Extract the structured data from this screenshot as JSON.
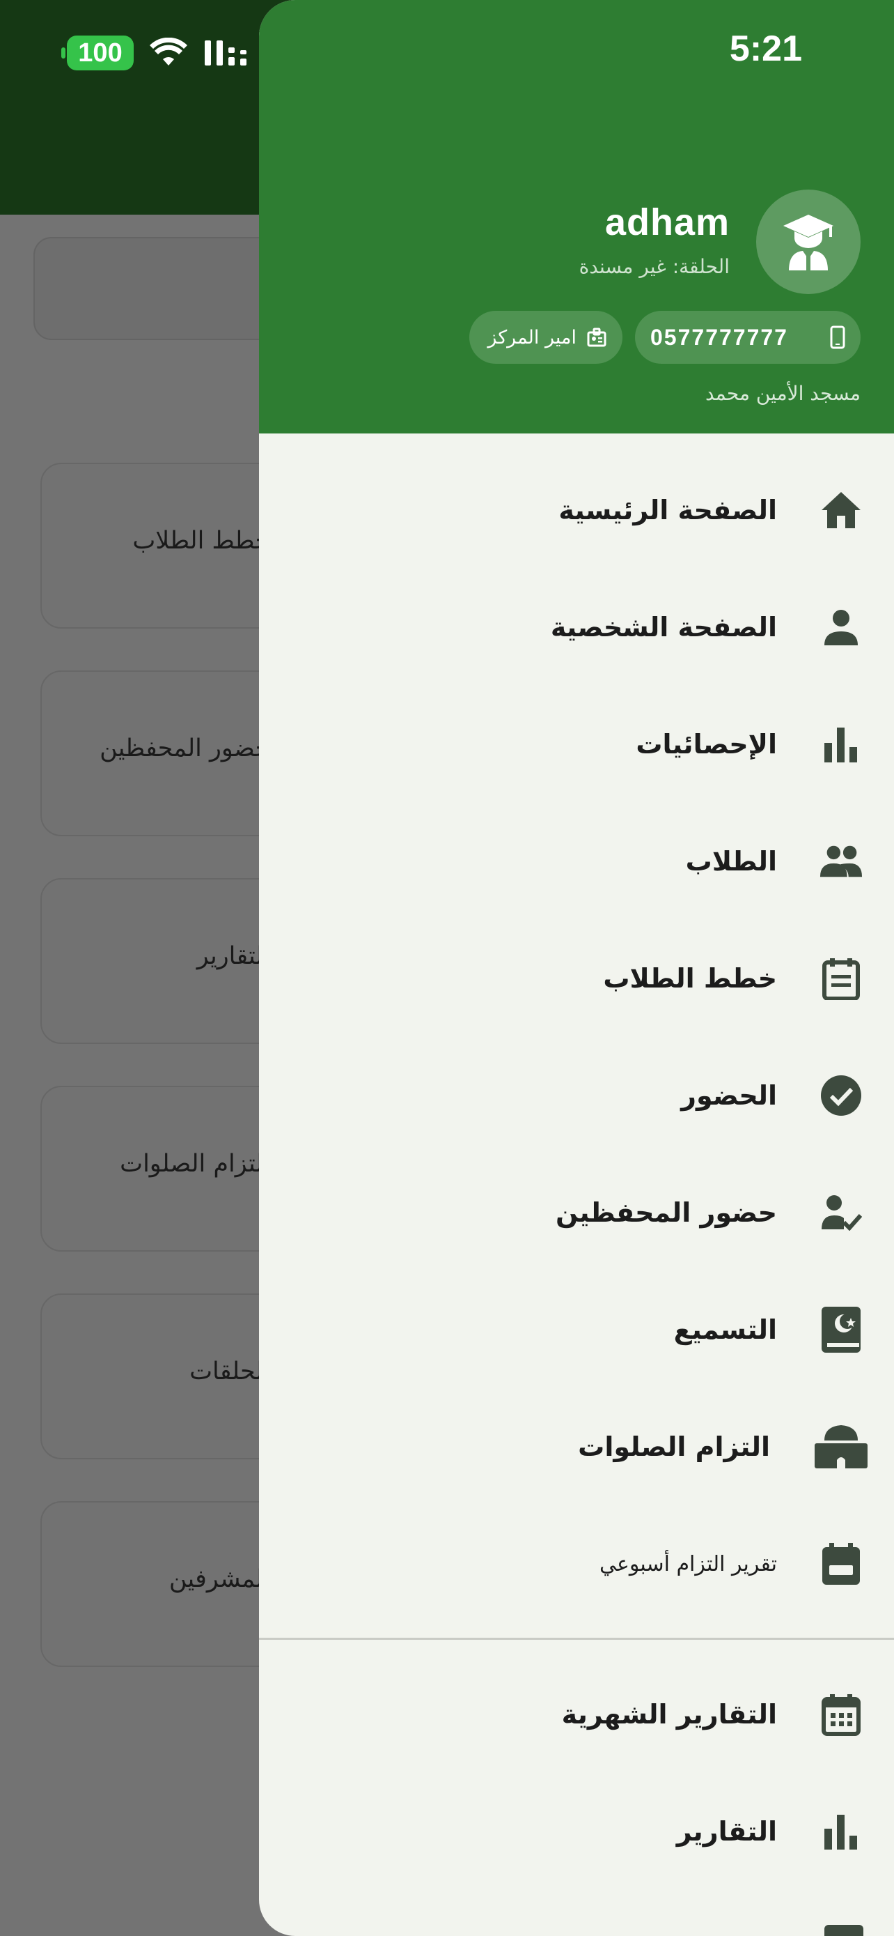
{
  "status_bar": {
    "time": "5:21",
    "battery": "100"
  },
  "background": {
    "cards": [
      "خطط الطلاب",
      "حضور المحفظين",
      "التقارير",
      "التزام الصلوات",
      "الحلقات",
      "المشرفين"
    ]
  },
  "drawer": {
    "user": {
      "name": "adham",
      "halaqa": "الحلقة: غير مسندة",
      "phone": "0577777777",
      "role": "امير المركز",
      "mosque": "مسجد الأمين محمد"
    },
    "menu": [
      {
        "label": "الصفحة الرئيسية",
        "icon": "home-icon"
      },
      {
        "label": "الصفحة الشخصية",
        "icon": "person-icon"
      },
      {
        "label": "الإحصائيات",
        "icon": "bar-chart-icon"
      },
      {
        "label": "الطلاب",
        "icon": "group-icon"
      },
      {
        "label": "خطط الطلاب",
        "icon": "plan-icon"
      },
      {
        "label": "الحضور",
        "icon": "check-circle-icon"
      },
      {
        "label": "حضور المحفظين",
        "icon": "person-check-icon"
      },
      {
        "label": "التسميع",
        "icon": "quran-book-icon"
      },
      {
        "label": "التزام الصلوات",
        "icon": "mosque-icon"
      },
      {
        "label": "تقرير التزام أسبوعي",
        "icon": "calendar-week-icon"
      },
      {
        "label": "التقارير الشهرية",
        "icon": "calendar-month-icon"
      },
      {
        "label": "التقارير",
        "icon": "report-chart-icon"
      }
    ]
  },
  "colors": {
    "header_green": "#2e7d32",
    "drawer_bg": "#f2f4ee",
    "scrim": "#737373",
    "icon": "#3d4a3e"
  }
}
